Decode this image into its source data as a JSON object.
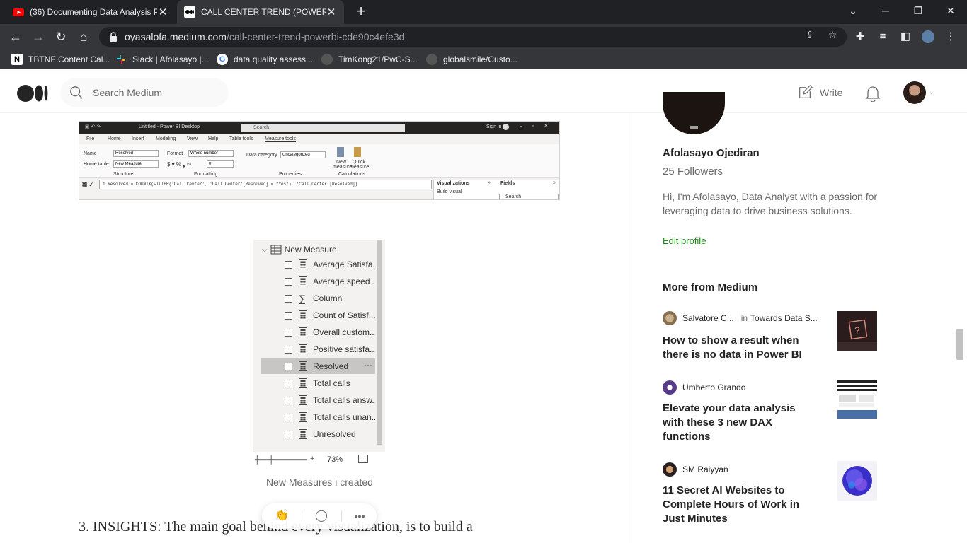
{
  "browser": {
    "tabs": [
      {
        "title": "(36) Documenting Data Analysis P",
        "icon": "youtube-icon",
        "active": false
      },
      {
        "title": "CALL CENTER TREND (POWERBI) |",
        "icon": "medium-icon",
        "active": true
      }
    ],
    "url_host": "oyasalofa.medium.com",
    "url_path": "/call-center-trend-powerbi-cde90c4efe3d",
    "bookmarks": [
      {
        "label": "TBTNF Content Cal...",
        "icon": "notion-icon"
      },
      {
        "label": "Slack | Afolasayo |...",
        "icon": "slack-icon"
      },
      {
        "label": "data quality assess...",
        "icon": "google-icon"
      },
      {
        "label": "TimKong21/PwC-S...",
        "icon": "github-icon"
      },
      {
        "label": "globalsmile/Custo...",
        "icon": "github-icon"
      }
    ]
  },
  "header": {
    "search_placeholder": "Search Medium",
    "write_label": "Write"
  },
  "pbi": {
    "title": "Untitled - Power BI Desktop",
    "search": "Search",
    "signin": "Sign in",
    "tabs": [
      "File",
      "Home",
      "Insert",
      "Modeling",
      "View",
      "Help",
      "Table tools",
      "Measure tools"
    ],
    "name_label": "Name",
    "name_value": "Resolved",
    "home_table_label": "Home table",
    "home_table_value": "New Measure",
    "format_label": "Format",
    "format_value": "Whole number",
    "decimals_value": "0",
    "data_category_label": "Data category",
    "data_category_value": "Uncategorized",
    "new_measure": "New measure",
    "quick_measure": "Quick measure",
    "group_structure": "Structure",
    "group_formatting": "Formatting",
    "group_properties": "Properties",
    "group_calculations": "Calculations",
    "formula": "1  Resolved = COUNTX(FILTER('Call Center', 'Call Center'[Resolved] = \"Yes\"), 'Call Center'[Resolved])",
    "visualizations": "Visualizations",
    "fields": "Fields",
    "build_visual": "Build visual",
    "fields_search": "Search"
  },
  "fields_pane": {
    "group": "New Measure",
    "items": [
      {
        "label": "Average Satisfa...",
        "icon": "calculator-icon",
        "selected": false
      },
      {
        "label": "Average speed ...",
        "icon": "calculator-icon",
        "selected": false
      },
      {
        "label": "Column",
        "icon": "sigma-icon",
        "selected": false
      },
      {
        "label": "Count of Satisf...",
        "icon": "calculator-icon",
        "selected": false
      },
      {
        "label": "Overall custom...",
        "icon": "calculator-icon",
        "selected": false
      },
      {
        "label": "Positive satisfa...",
        "icon": "calculator-icon",
        "selected": false
      },
      {
        "label": "Resolved",
        "icon": "calculator-icon",
        "selected": true
      },
      {
        "label": "Total calls",
        "icon": "calculator-icon",
        "selected": false
      },
      {
        "label": "Total calls answ...",
        "icon": "calculator-icon",
        "selected": false
      },
      {
        "label": "Total calls unan...",
        "icon": "calculator-icon",
        "selected": false
      },
      {
        "label": "Unresolved",
        "icon": "calculator-icon",
        "selected": false
      }
    ],
    "zoom": "73%",
    "more": "···"
  },
  "article": {
    "caption": "New Measures i created",
    "body_line": "3. INSIGHTS: The main goal behind every visualization, is to build a"
  },
  "sidebar": {
    "author_name": "Afolasayo Ojediran",
    "followers": "25 Followers",
    "bio": "Hi, I'm Afolasayo, Data Analyst with a passion for leveraging data to drive business solutions.",
    "edit_profile": "Edit profile",
    "more_from": "More from Medium",
    "cards": [
      {
        "author": "Salvatore C...",
        "in": "in",
        "publication": "Towards Data S...",
        "title": "How to show a result when there is no data in Power BI"
      },
      {
        "author": "Umberto Grando",
        "title": "Elevate your data analysis with these 3 new DAX functions"
      },
      {
        "author": "SM Raiyyan",
        "title": "11 Secret AI Websites to Complete Hours of Work in Just Minutes"
      }
    ]
  },
  "colors": {
    "accent_green": "#1a8917",
    "chrome_dark": "#202124",
    "chrome_mid": "#35363a"
  }
}
